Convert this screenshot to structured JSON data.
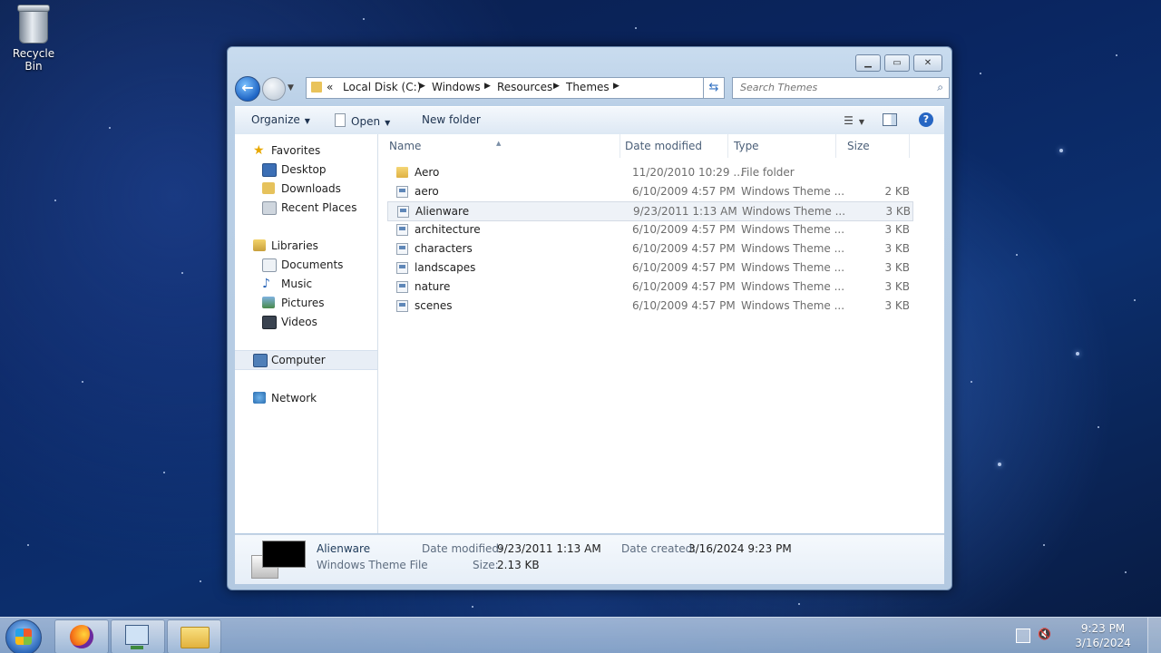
{
  "desktop": {
    "recycle_bin_label": "Recycle Bin"
  },
  "window": {
    "caption_buttons": [
      "minimize",
      "maximize",
      "close"
    ],
    "address": {
      "prefix": "«",
      "crumbs": [
        "Local Disk (C:)",
        "Windows",
        "Resources",
        "Themes"
      ]
    },
    "search_placeholder": "Search Themes",
    "toolbar": {
      "organize": "Organize",
      "open": "Open",
      "new_folder": "New folder"
    },
    "nav": {
      "favorites": "Favorites",
      "desktop": "Desktop",
      "downloads": "Downloads",
      "recent_places": "Recent Places",
      "libraries": "Libraries",
      "documents": "Documents",
      "music": "Music",
      "pictures": "Pictures",
      "videos": "Videos",
      "computer": "Computer",
      "network": "Network"
    },
    "columns": {
      "name": "Name",
      "date_modified": "Date modified",
      "type": "Type",
      "size": "Size"
    },
    "files": [
      {
        "name": "Aero",
        "date": "11/20/2010 10:29 ...",
        "type": "File folder",
        "size": "",
        "kind": "folder"
      },
      {
        "name": "aero",
        "date": "6/10/2009 4:57 PM",
        "type": "Windows Theme ...",
        "size": "2 KB",
        "kind": "theme"
      },
      {
        "name": "Alienware",
        "date": "9/23/2011 1:13 AM",
        "type": "Windows Theme ...",
        "size": "3 KB",
        "kind": "theme"
      },
      {
        "name": "architecture",
        "date": "6/10/2009 4:57 PM",
        "type": "Windows Theme ...",
        "size": "3 KB",
        "kind": "theme"
      },
      {
        "name": "characters",
        "date": "6/10/2009 4:57 PM",
        "type": "Windows Theme ...",
        "size": "3 KB",
        "kind": "theme"
      },
      {
        "name": "landscapes",
        "date": "6/10/2009 4:57 PM",
        "type": "Windows Theme ...",
        "size": "3 KB",
        "kind": "theme"
      },
      {
        "name": "nature",
        "date": "6/10/2009 4:57 PM",
        "type": "Windows Theme ...",
        "size": "3 KB",
        "kind": "theme"
      },
      {
        "name": "scenes",
        "date": "6/10/2009 4:57 PM",
        "type": "Windows Theme ...",
        "size": "3 KB",
        "kind": "theme"
      }
    ],
    "selected_file": "Alienware",
    "details": {
      "name": "Alienware",
      "type": "Windows Theme File",
      "date_modified_label": "Date modified:",
      "date_modified": "9/23/2011 1:13 AM",
      "date_created_label": "Date created:",
      "date_created": "3/16/2024 9:23 PM",
      "size_label": "Size:",
      "size": "2.13 KB"
    }
  },
  "taskbar": {
    "pinned": [
      "firefox-icon",
      "remote-desktop-icon",
      "file-explorer-icon"
    ],
    "clock_time": "9:23 PM",
    "clock_date": "3/16/2024"
  }
}
